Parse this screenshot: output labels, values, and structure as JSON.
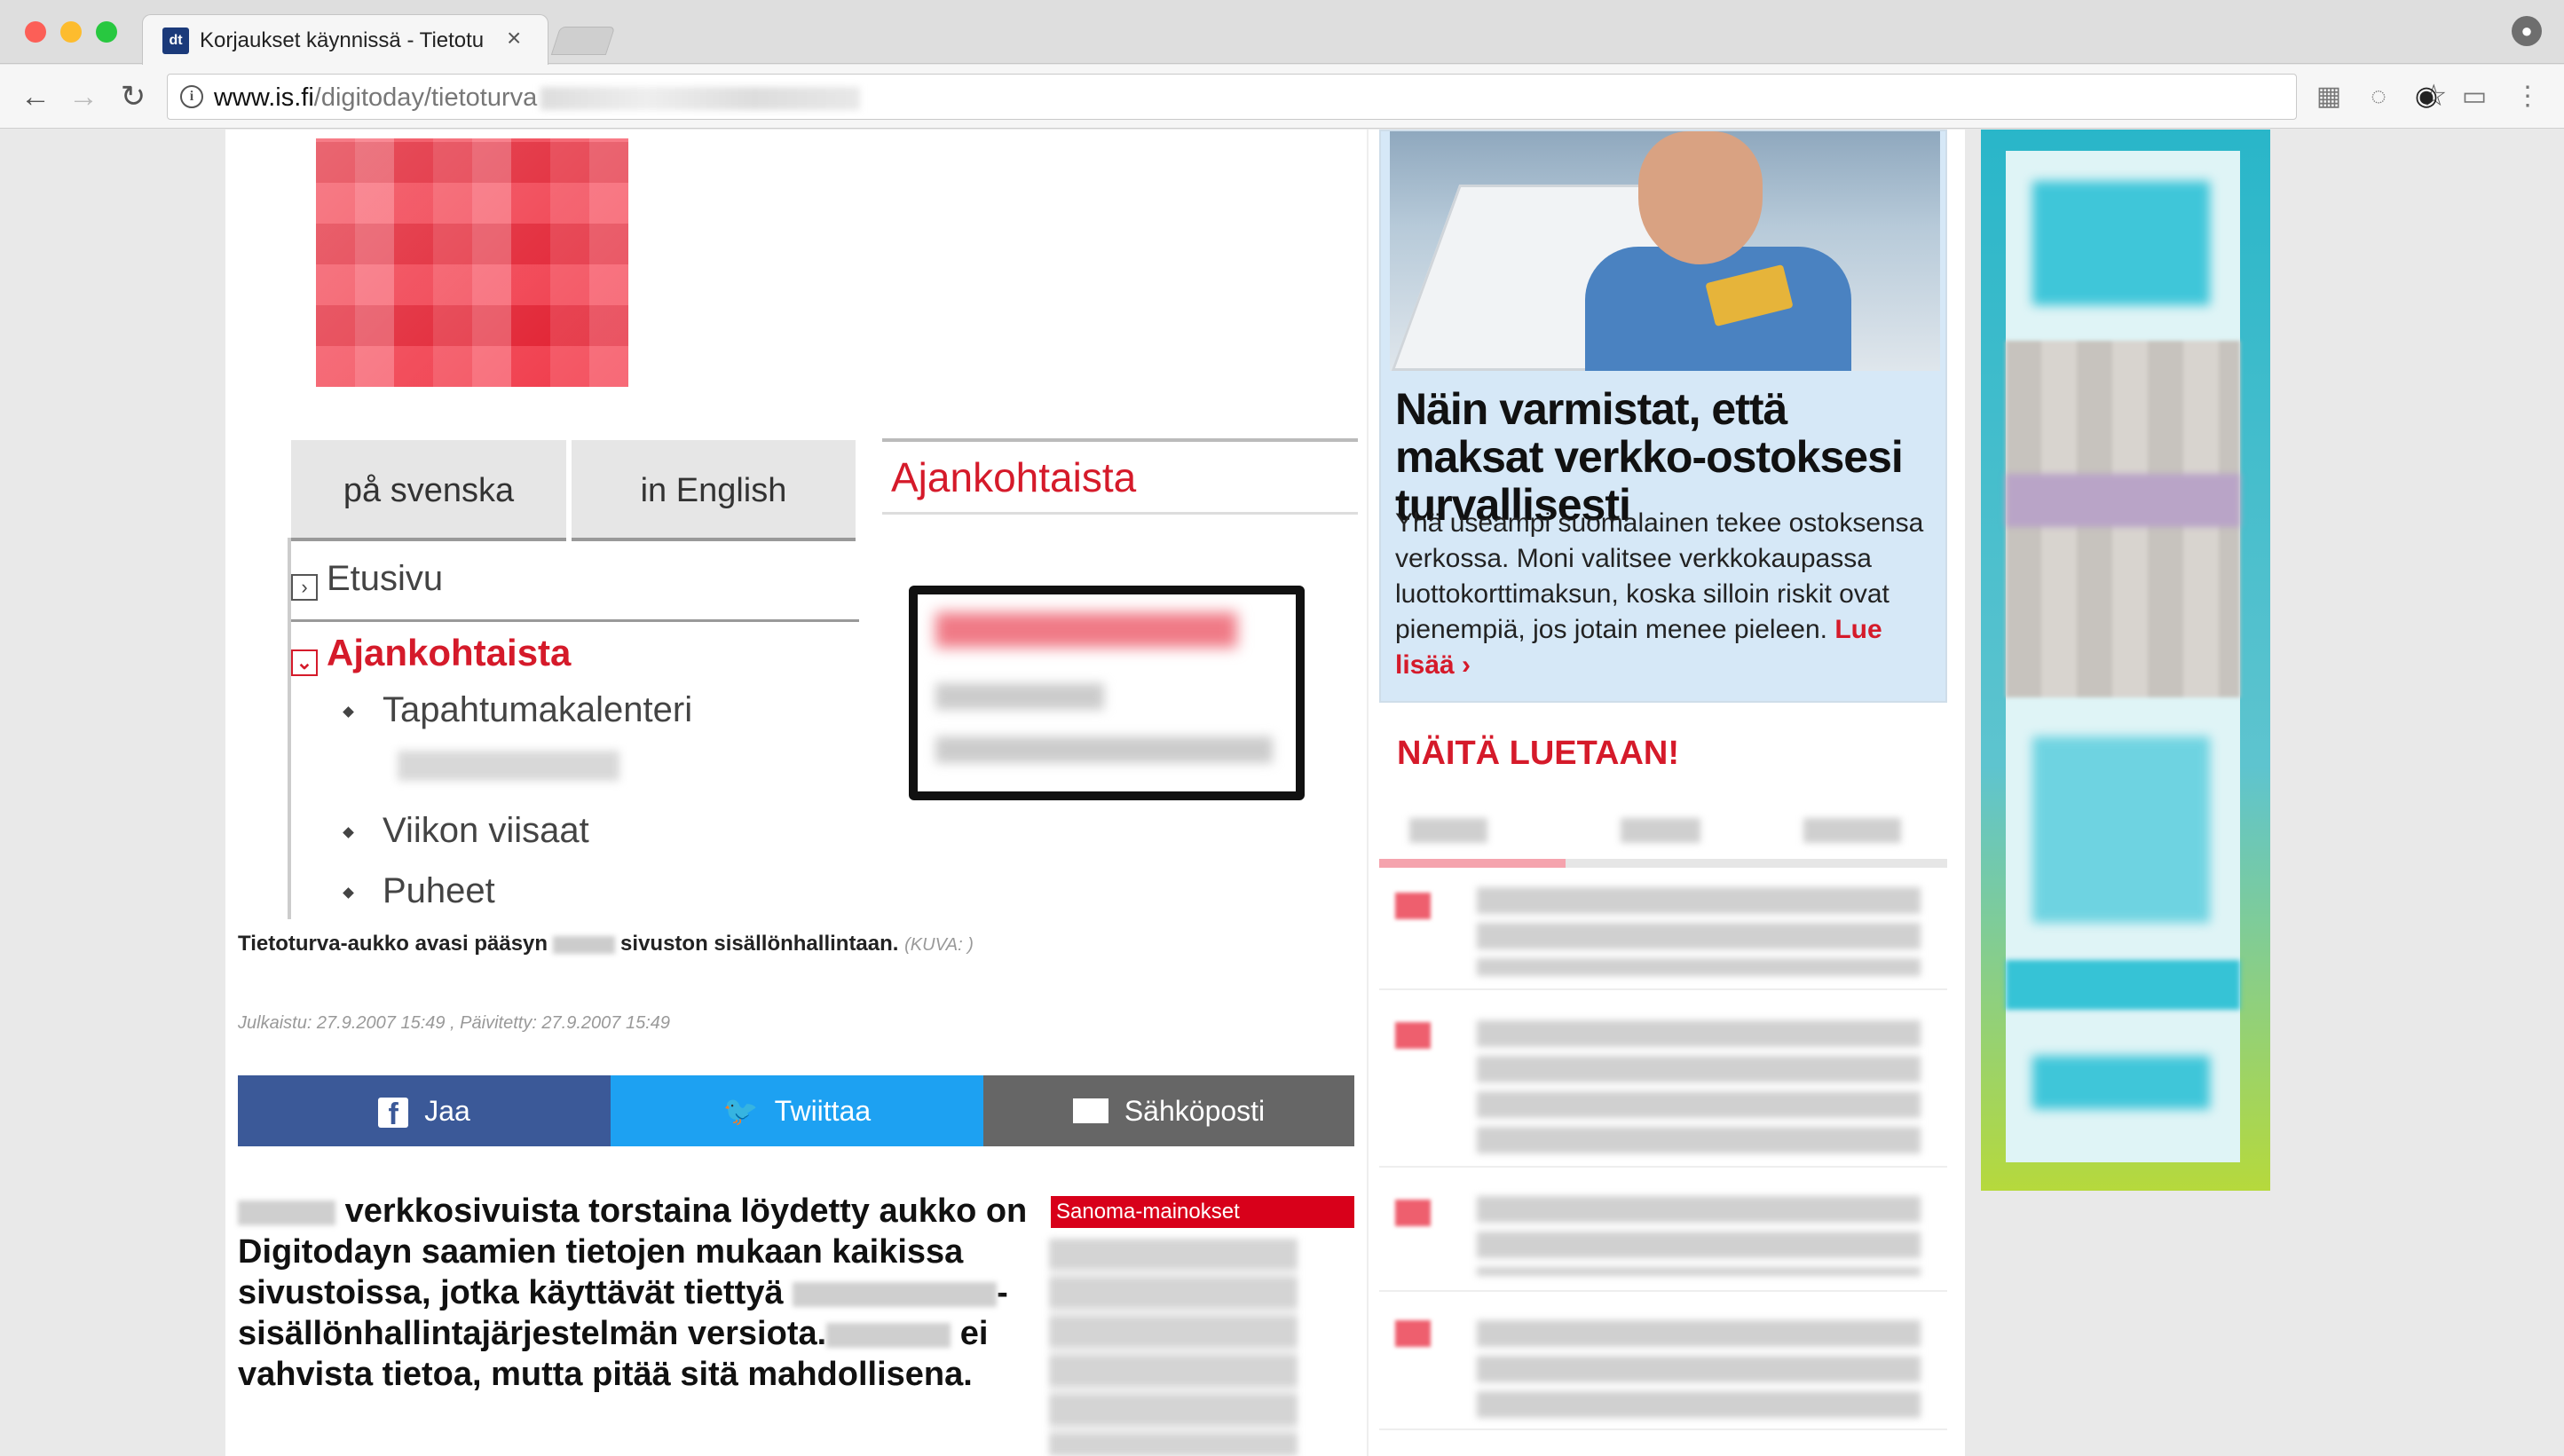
{
  "browser": {
    "tab_favicon": "dt",
    "tab_title": "Korjaukset käynnissä - Tietotu",
    "tab_close": "×",
    "url_host": "www.is.fi",
    "url_path": "/digitoday/tietoturva",
    "nav_back": "←",
    "nav_forward": "→",
    "nav_reload": "↻",
    "star": "☆",
    "menu": "⋮",
    "profile_icon": "person-icon"
  },
  "figure": {
    "lang_sv": "på svenska",
    "lang_en": "in English",
    "section_heading": "Ajankohtaista",
    "menu_home": "Etusivu",
    "menu_current": "Ajankohtaista",
    "submenu": [
      "Tapahtumakalenteri",
      "Viikon viisaat",
      "Puheet"
    ]
  },
  "caption": {
    "text_before": "Tietoturva-aukko avasi pääsyn",
    "text_after": "sivuston sisällönhallintaan.",
    "credit": "(KUVA: )"
  },
  "dates": "Julkaistu: 27.9.2007 15:49 , Päivitetty: 27.9.2007 15:49",
  "share": {
    "facebook": "Jaa",
    "twitter": "Twiittaa",
    "email": "Sähköposti"
  },
  "lead": {
    "p1": "verkkosivuista torstaina löydetty aukko on Digitodayn saamien tietojen mukaan kaikissa sivustoissa, jotka käyttävät tiettyä",
    "p2": "-sisällönhallintajärjestelmän versiota.",
    "p3": "ei vahvista tietoa, mutta pitää sitä mahdollisena."
  },
  "ad_label": "Sanoma-mainokset",
  "promo": {
    "title": "Näin varmistat, että maksat verkko-ostoksesi turvallisesti",
    "text": "Yhä useampi suomalainen tekee ostoksensa verkossa. Moni valitsee verkkokaupassa luottokorttimaksun, koska silloin riskit ovat pienempiä, jos jotain menee pieleen.",
    "more": "Lue lisää ›"
  },
  "most_read": {
    "heading": "NÄITÄ LUETAAN!"
  },
  "colors": {
    "brand_red": "#d51a2a",
    "facebook": "#3b5998",
    "twitter": "#1da1f2",
    "email": "#666666",
    "promo_bg": "#d6e8f7"
  }
}
